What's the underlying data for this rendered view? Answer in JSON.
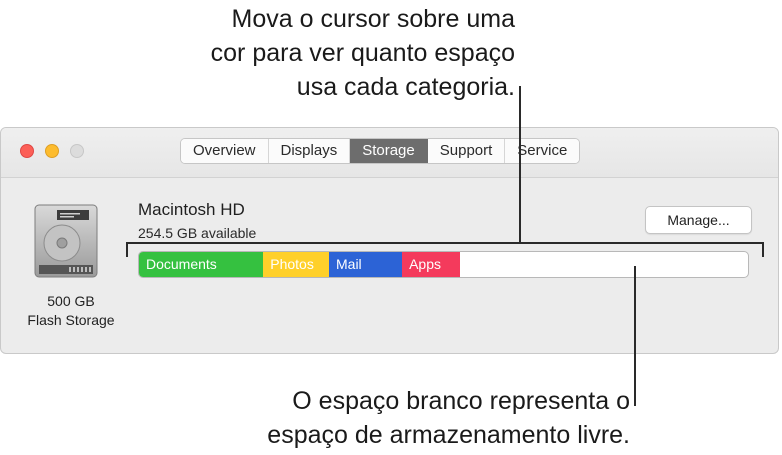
{
  "callouts": {
    "top": "Mova o cursor sobre uma\ncor para ver quanto espaço\nusa cada categoria.",
    "bottom": "O espaço branco representa o\nespaço de armazenamento livre."
  },
  "window": {
    "traffic_lights": [
      "close",
      "minimize",
      "zoom"
    ],
    "tabs": [
      {
        "label": "Overview",
        "active": false
      },
      {
        "label": "Displays",
        "active": false
      },
      {
        "label": "Storage",
        "active": true
      },
      {
        "label": "Support",
        "active": false
      },
      {
        "label": "Service",
        "active": false
      }
    ]
  },
  "storage": {
    "disk_icon": "hard-drive-icon",
    "disk_caption": "500 GB\nFlash Storage",
    "volume_name": "Macintosh HD",
    "available": "254.5 GB available",
    "manage_label": "Manage...",
    "segments": [
      {
        "label": "Documents",
        "color": "#35c140",
        "fraction": 0.204
      },
      {
        "label": "Photos",
        "color": "#ffd02a",
        "fraction": 0.108
      },
      {
        "label": "Mail",
        "color": "#2c63d6",
        "fraction": 0.12
      },
      {
        "label": "Apps",
        "color": "#f43a5c",
        "fraction": 0.095
      }
    ]
  },
  "colors": {
    "tab_active_bg": "#6d6d6d",
    "window_bg": "#ececec"
  }
}
